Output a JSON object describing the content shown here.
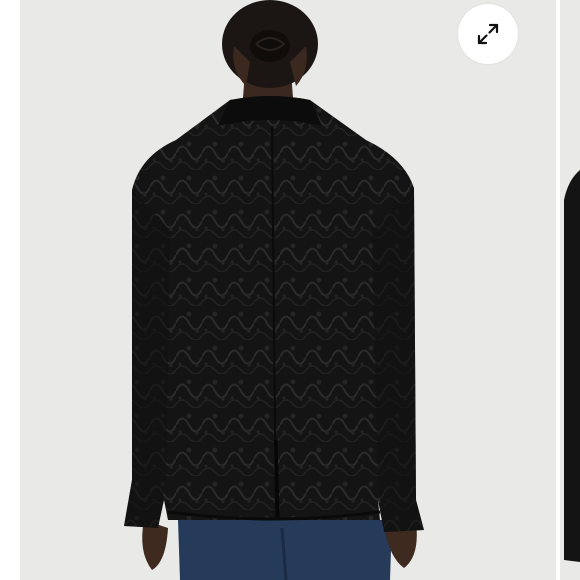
{
  "gallery": {
    "main_image_alt": "",
    "expand_icon": "expand-arrows-icon",
    "colors": {
      "background": "#ffffff",
      "photo_backdrop": "#e9e9e7",
      "blazer": "#121212",
      "button": "#ffffff",
      "icon": "#111111"
    }
  }
}
